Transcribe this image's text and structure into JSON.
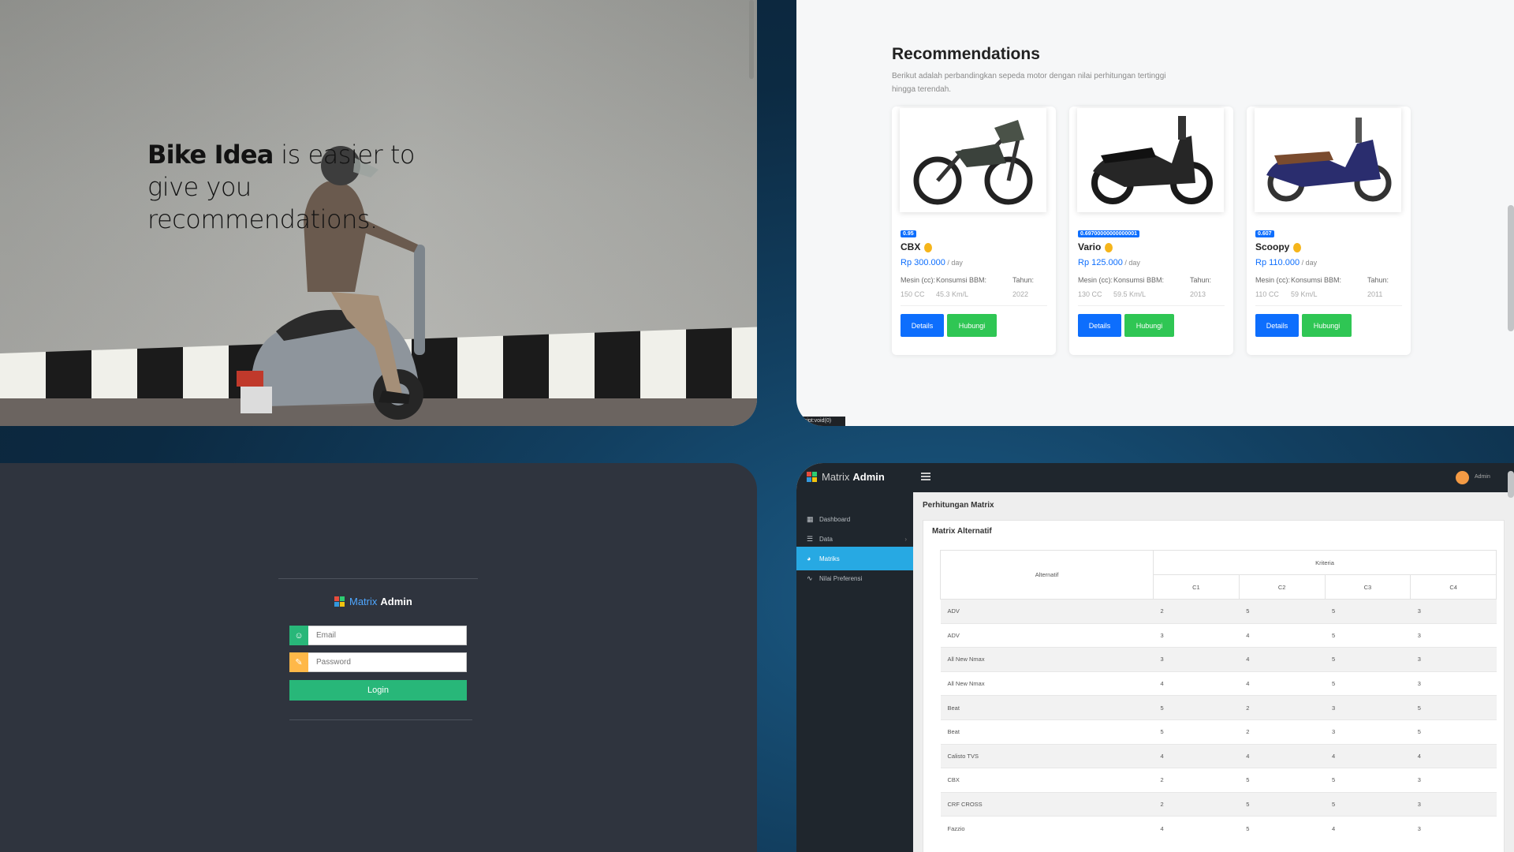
{
  "hero": {
    "brand": "Bike Idea",
    "tagline": " is easier to give you recommendations."
  },
  "recommendations": {
    "title": "Recommendations",
    "description": "Berikut adalah perbandingkan sepeda motor dengan nilai perhitungan tertinggi hingga terendah.",
    "cards": [
      {
        "score": "0.95",
        "name": "CBX",
        "price": "Rp 300.000",
        "per": " / day",
        "mesin_label": "Mesin (cc):",
        "mesin": "150 CC",
        "bbm_label": "Konsumsi BBM:",
        "bbm": "45.3 Km/L",
        "tahun_label": "Tahun:",
        "tahun": "2022",
        "details": "Details",
        "hubungi": "Hubungi"
      },
      {
        "score": "0.69700000000000001",
        "name": "Vario",
        "price": "Rp 125.000",
        "per": " / day",
        "mesin_label": "Mesin (cc):",
        "mesin": "130 CC",
        "bbm_label": "Konsumsi BBM:",
        "bbm": "59.5 Km/L",
        "tahun_label": "Tahun:",
        "tahun": "2013",
        "details": "Details",
        "hubungi": "Hubungi"
      },
      {
        "score": "0.607",
        "name": "Scoopy",
        "price": "Rp 110.000",
        "per": " / day",
        "mesin_label": "Mesin (cc):",
        "mesin": "110 CC",
        "bbm_label": "Konsumsi BBM:",
        "bbm": "59 Km/L",
        "tahun_label": "Tahun:",
        "tahun": "2011",
        "details": "Details",
        "hubungi": "Hubungi"
      }
    ],
    "status_url": "script:void(0)"
  },
  "login": {
    "logo_part1": "Matrix",
    "logo_part2": "Admin",
    "email_placeholder": "Email",
    "password_placeholder": "Password",
    "login_label": "Login"
  },
  "admin": {
    "logo_part1": "Matrix",
    "logo_part2": "Admin",
    "user": "Admin",
    "sidebar": [
      {
        "label": "Dashboard",
        "icon": "dashboard-icon"
      },
      {
        "label": "Data",
        "icon": "list-icon"
      },
      {
        "label": "Matriks",
        "icon": "chart-pie-icon"
      },
      {
        "label": "Nilai Preferensi",
        "icon": "line-chart-icon"
      }
    ],
    "breadcrumb": "Perhitungan Matrix",
    "box_title": "Matrix Alternatif",
    "table": {
      "col_alternatif": "Alternatif",
      "col_kriteria": "Kriteria",
      "criteria": [
        "C1",
        "C2",
        "C3",
        "C4"
      ],
      "rows": [
        {
          "name": "ADV",
          "values": [
            "2",
            "5",
            "5",
            "3"
          ]
        },
        {
          "name": "ADV",
          "values": [
            "3",
            "4",
            "5",
            "3"
          ]
        },
        {
          "name": "All New Nmax",
          "values": [
            "3",
            "4",
            "5",
            "3"
          ]
        },
        {
          "name": "All New Nmax",
          "values": [
            "4",
            "4",
            "5",
            "3"
          ]
        },
        {
          "name": "Beat",
          "values": [
            "5",
            "2",
            "3",
            "5"
          ]
        },
        {
          "name": "Beat",
          "values": [
            "5",
            "2",
            "3",
            "5"
          ]
        },
        {
          "name": "Calisto TVS",
          "values": [
            "4",
            "4",
            "4",
            "4"
          ]
        },
        {
          "name": "CBX",
          "values": [
            "2",
            "5",
            "5",
            "3"
          ]
        },
        {
          "name": "CRF CROSS",
          "values": [
            "2",
            "5",
            "5",
            "3"
          ]
        },
        {
          "name": "Fazzio",
          "values": [
            "4",
            "5",
            "4",
            "3"
          ]
        }
      ]
    }
  },
  "colors": {
    "primary": "#0d6efd",
    "success": "#2fc654",
    "login_green": "#28b779",
    "sidebar_active": "#27a9e3",
    "admin_dark": "#1f262d"
  }
}
